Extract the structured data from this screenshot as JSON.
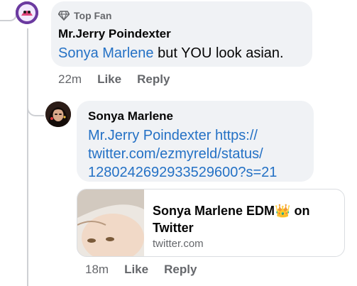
{
  "comment": {
    "badge": "Top Fan",
    "author": "Mr.Jerry Poindexter",
    "mention": "Sonya Marlene",
    "text": " but YOU look asian.",
    "time": "22m",
    "like": "Like",
    "reply": "Reply"
  },
  "reply": {
    "author": "Sonya Marlene",
    "mention": "Mr.Jerry Poindexter",
    "url_line1": " https://",
    "url_line2": "twitter.com/ezmyreld/status/",
    "url_line3": "1280242692933529600?s=21",
    "time": "18m",
    "like": "Like",
    "reply": "Reply"
  },
  "link_card": {
    "title_part1": "Sonya Marlene EDM",
    "emoji": "👑",
    "title_part2": " on",
    "title_line2": "Twitter",
    "domain": "twitter.com"
  },
  "icons": {
    "badge_icon": "diamond-icon",
    "card_thumb": "profile-photo"
  }
}
